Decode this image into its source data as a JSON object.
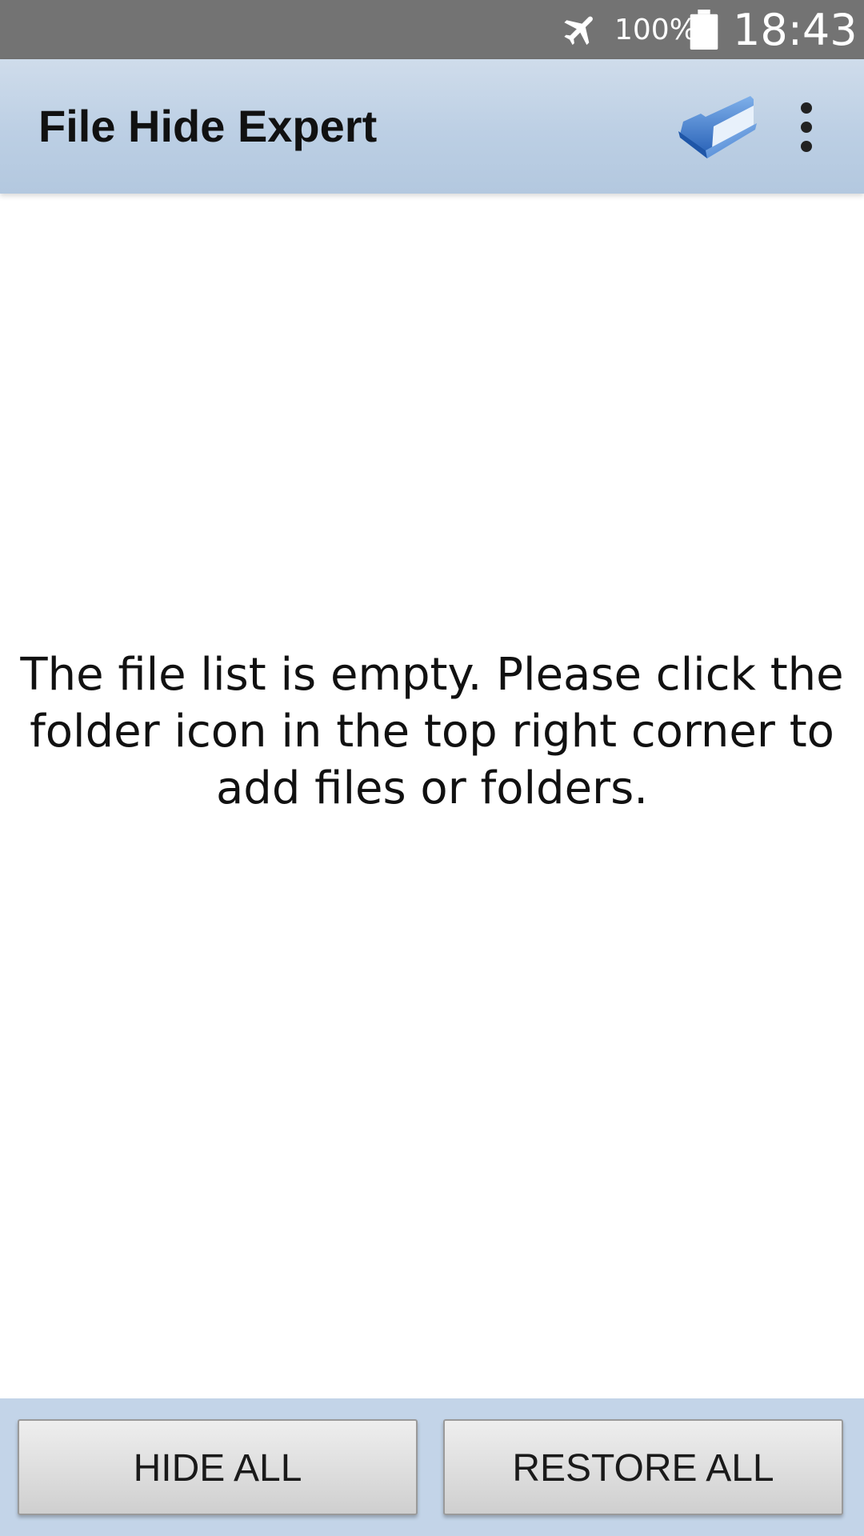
{
  "status_bar": {
    "battery_percent": "100%",
    "time": "18:43",
    "icons": [
      "airplane-mode-icon",
      "battery-icon"
    ]
  },
  "action_bar": {
    "title": "File Hide Expert",
    "icons": [
      "folder-icon",
      "overflow-menu-icon"
    ]
  },
  "main": {
    "empty_message": "The file list is empty. Please click the folder icon in the top right corner to add files or folders."
  },
  "bottom_bar": {
    "hide_all_label": "HIDE ALL",
    "restore_all_label": "RESTORE ALL"
  },
  "colors": {
    "status_bar": "#737373",
    "action_bar": "#bccfe4",
    "bottom_bar": "#c3d4e8",
    "folder_icon": "#2f6fc6"
  }
}
